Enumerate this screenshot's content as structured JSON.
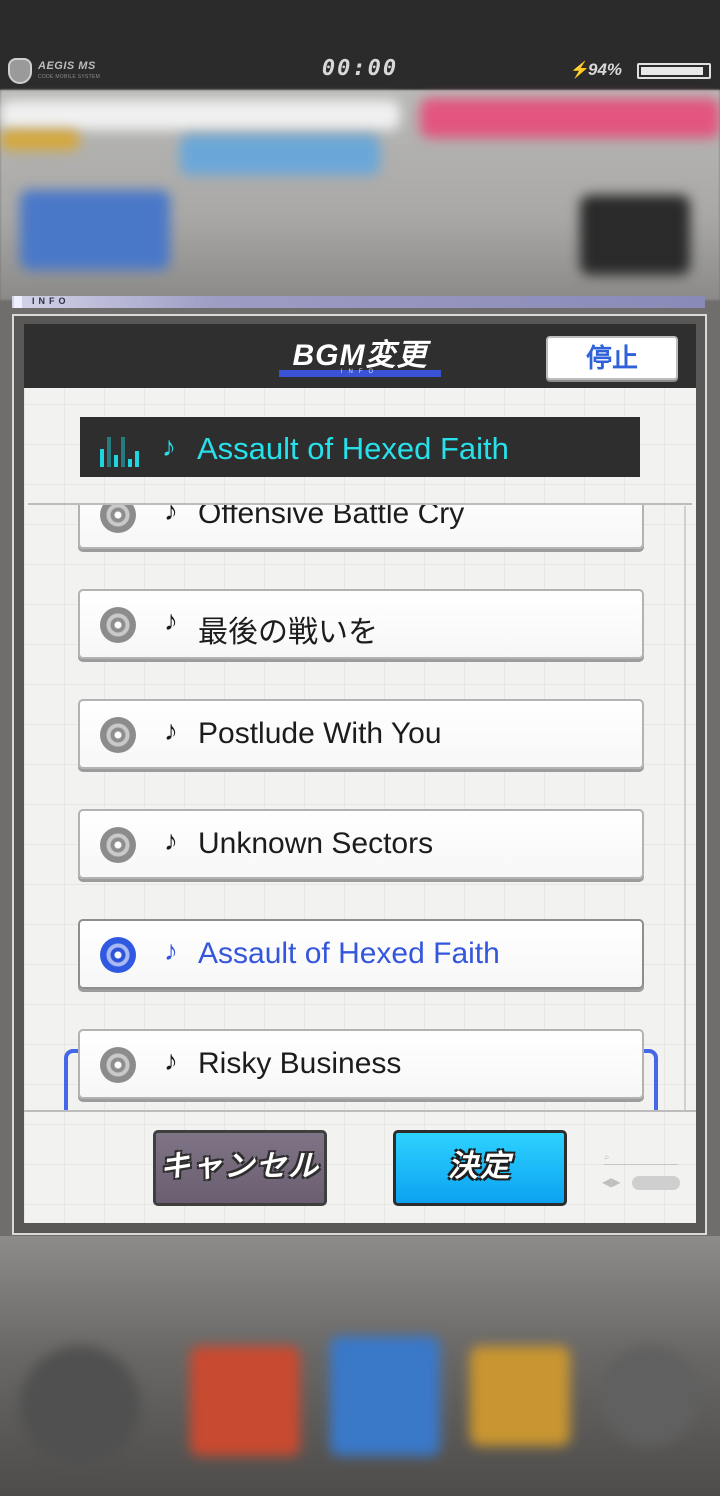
{
  "status_bar": {
    "app_logo": "AEGIS MS",
    "app_logo_sub": "CODE MOBILE SYSTEM",
    "clock": "00:00",
    "battery_percent": "94%",
    "battery_level": 0.94
  },
  "info_strip": {
    "label": "INFO"
  },
  "dialog": {
    "title": "BGM変更",
    "title_sub": "INFO",
    "stop_label": "停止",
    "now_playing": {
      "note": "♪",
      "title": "Assault of Hexed Faith"
    },
    "songs": [
      {
        "note": "♪",
        "title": "Offensive Battle Cry",
        "selected": false
      },
      {
        "note": "♪",
        "title": "最後の戦いを",
        "selected": false
      },
      {
        "note": "♪",
        "title": "Postlude With You",
        "selected": false
      },
      {
        "note": "♪",
        "title": "Unknown Sectors",
        "selected": false
      },
      {
        "note": "♪",
        "title": "Assault of Hexed Faith",
        "selected": true
      },
      {
        "note": "♪",
        "title": "Risky Business",
        "selected": false
      }
    ],
    "cancel_label": "キャンセル",
    "confirm_label": "決定"
  },
  "colors": {
    "accent_blue": "#3456dc",
    "now_playing_cyan": "#27e0ea",
    "confirm_button": "#0ba2f0",
    "cancel_button": "#6a5e70"
  },
  "icons": {
    "disc": "disc-icon",
    "equalizer": "equalizer-icon",
    "battery": "battery-icon",
    "charging": "lightning-bolt-icon"
  }
}
